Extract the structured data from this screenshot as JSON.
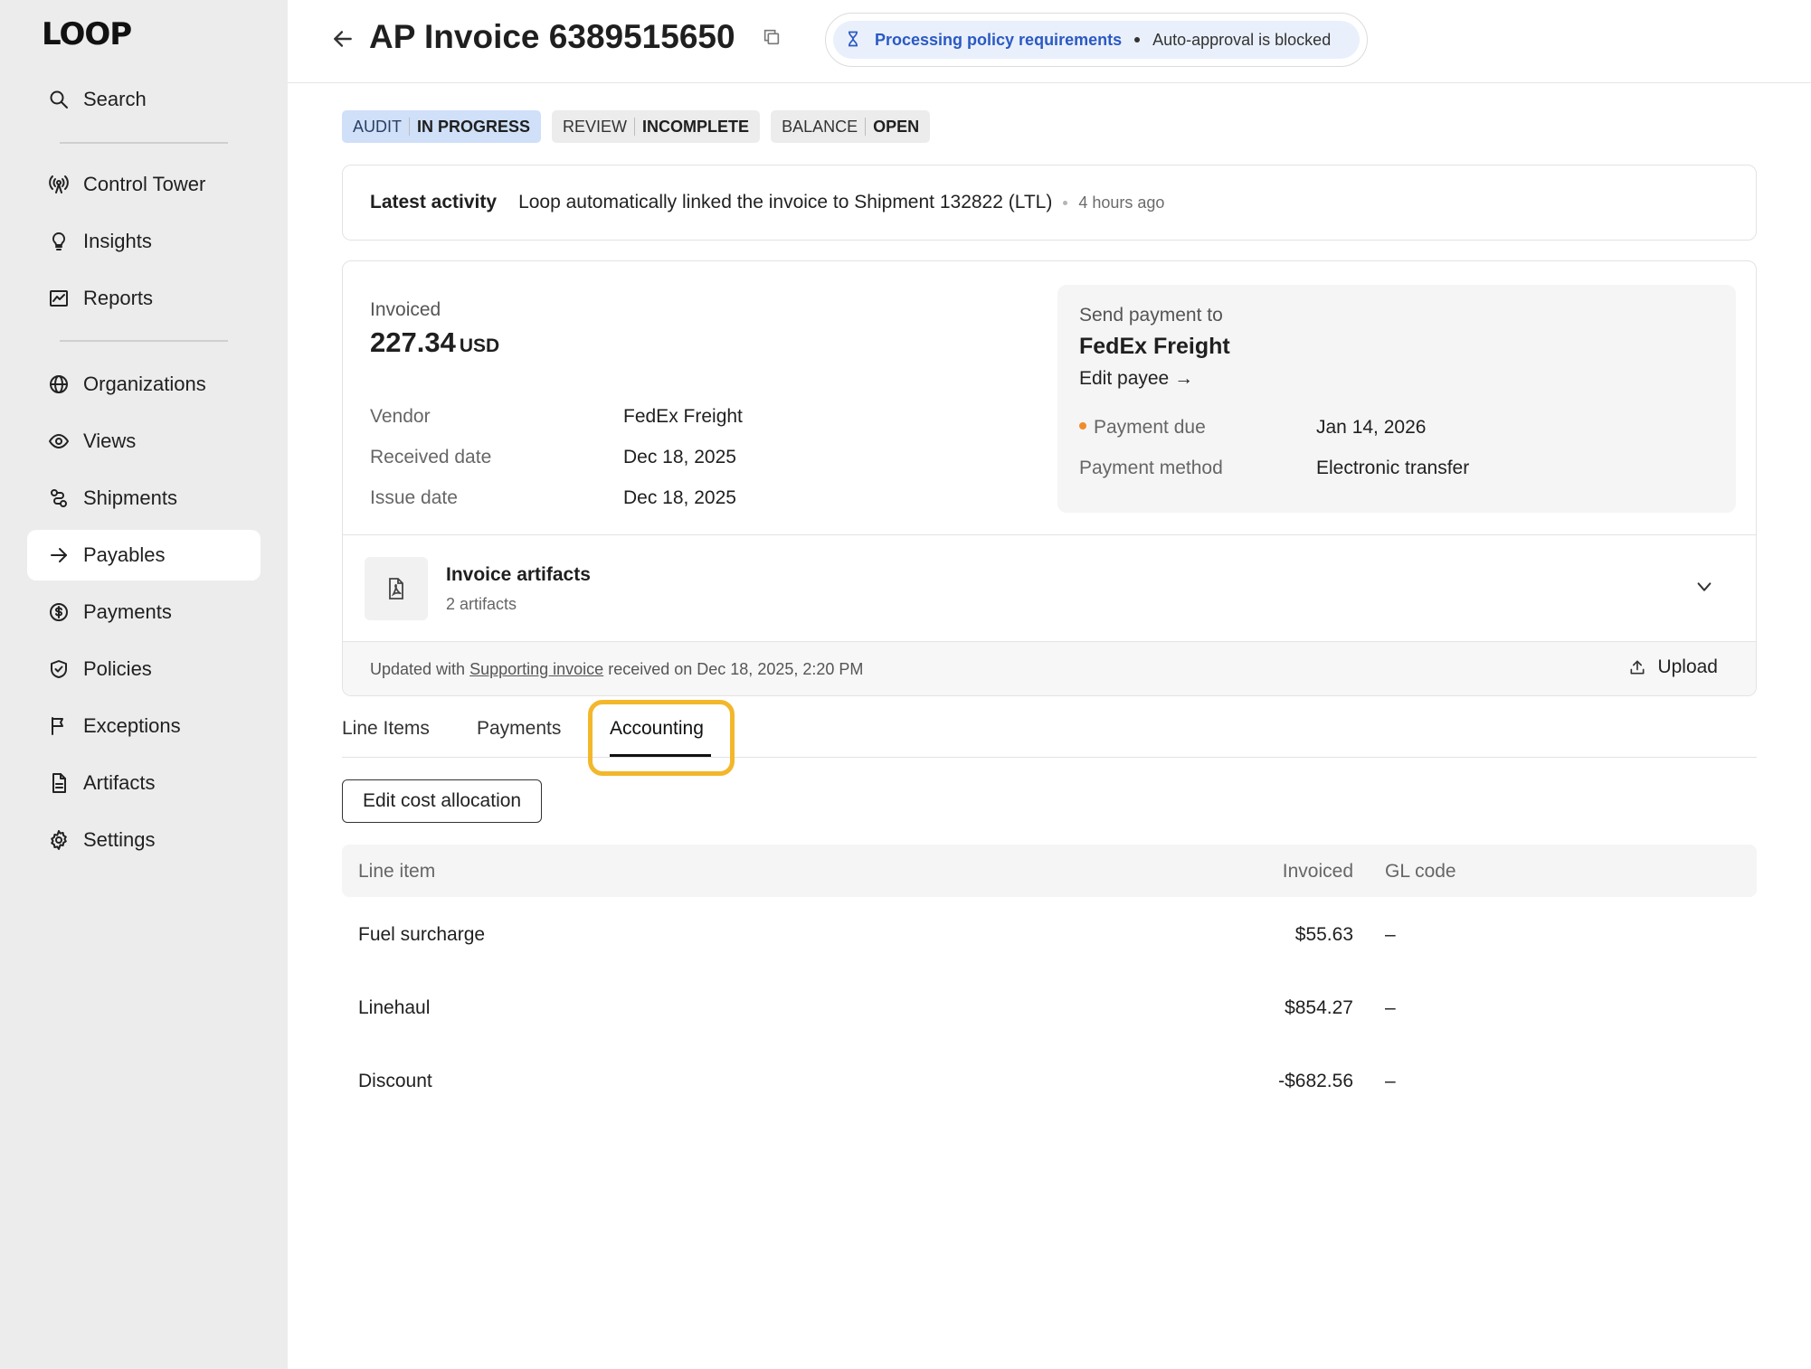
{
  "app": {
    "logo": "LOOP"
  },
  "sidebar": {
    "items": [
      {
        "label": "Search",
        "icon": "search-icon"
      },
      {
        "label": "Control Tower",
        "icon": "radio-tower-icon"
      },
      {
        "label": "Insights",
        "icon": "lightbulb-icon"
      },
      {
        "label": "Reports",
        "icon": "chart-icon"
      },
      {
        "label": "Organizations",
        "icon": "globe-icon"
      },
      {
        "label": "Views",
        "icon": "eye-icon"
      },
      {
        "label": "Shipments",
        "icon": "route-icon"
      },
      {
        "label": "Payables",
        "icon": "arrow-right-icon",
        "active": true
      },
      {
        "label": "Payments",
        "icon": "dollar-circle-icon"
      },
      {
        "label": "Policies",
        "icon": "shield-check-icon"
      },
      {
        "label": "Exceptions",
        "icon": "flag-icon"
      },
      {
        "label": "Artifacts",
        "icon": "file-icon"
      },
      {
        "label": "Settings",
        "icon": "gear-icon"
      }
    ]
  },
  "header": {
    "title": "AP Invoice 6389515650",
    "status": {
      "primary": "Processing policy requirements",
      "secondary": "Auto-approval is blocked",
      "color": "#2b59c3"
    }
  },
  "badges": [
    {
      "label": "AUDIT",
      "value": "IN PROGRESS",
      "color": "#cfe0f8"
    },
    {
      "label": "REVIEW",
      "value": "INCOMPLETE",
      "color": "#ececec"
    },
    {
      "label": "BALANCE",
      "value": "OPEN",
      "color": "#ececec"
    }
  ],
  "activity": {
    "label": "Latest activity",
    "text": "Loop automatically linked the invoice to Shipment 132822 (LTL)",
    "time": "4 hours ago"
  },
  "summary": {
    "invoiced_label": "Invoiced",
    "amount": "227.34",
    "currency": "USD",
    "details": [
      {
        "key": "Vendor",
        "value": "FedEx Freight"
      },
      {
        "key": "Received date",
        "value": "Dec 18, 2025"
      },
      {
        "key": "Issue date",
        "value": "Dec 18, 2025"
      }
    ],
    "payto": {
      "label": "Send payment to",
      "name": "FedEx Freight",
      "edit_label": "Edit payee →",
      "due_label": "Payment due",
      "due_value": "Jan 14, 2026",
      "due_dot_color": "#f28b2a",
      "method_label": "Payment method",
      "method_value": "Electronic transfer"
    },
    "artifacts": {
      "title": "Invoice artifacts",
      "count": "2 artifacts"
    },
    "updated": {
      "prefix": "Updated with",
      "link": "Supporting invoice",
      "suffix": "received on Dec 18, 2025, 2:20 PM"
    },
    "upload_label": "Upload"
  },
  "tabs": [
    {
      "label": "Line Items"
    },
    {
      "label": "Payments"
    },
    {
      "label": "Accounting",
      "active": true
    }
  ],
  "accounting": {
    "edit_button": "Edit cost allocation",
    "columns": {
      "item": "Line item",
      "invoiced": "Invoiced",
      "gl": "GL code"
    },
    "rows": [
      {
        "item": "Fuel surcharge",
        "invoiced": "$55.63",
        "gl": "–"
      },
      {
        "item": "Linehaul",
        "invoiced": "$854.27",
        "gl": "–"
      },
      {
        "item": "Discount",
        "invoiced": "-$682.56",
        "gl": "–"
      }
    ]
  }
}
